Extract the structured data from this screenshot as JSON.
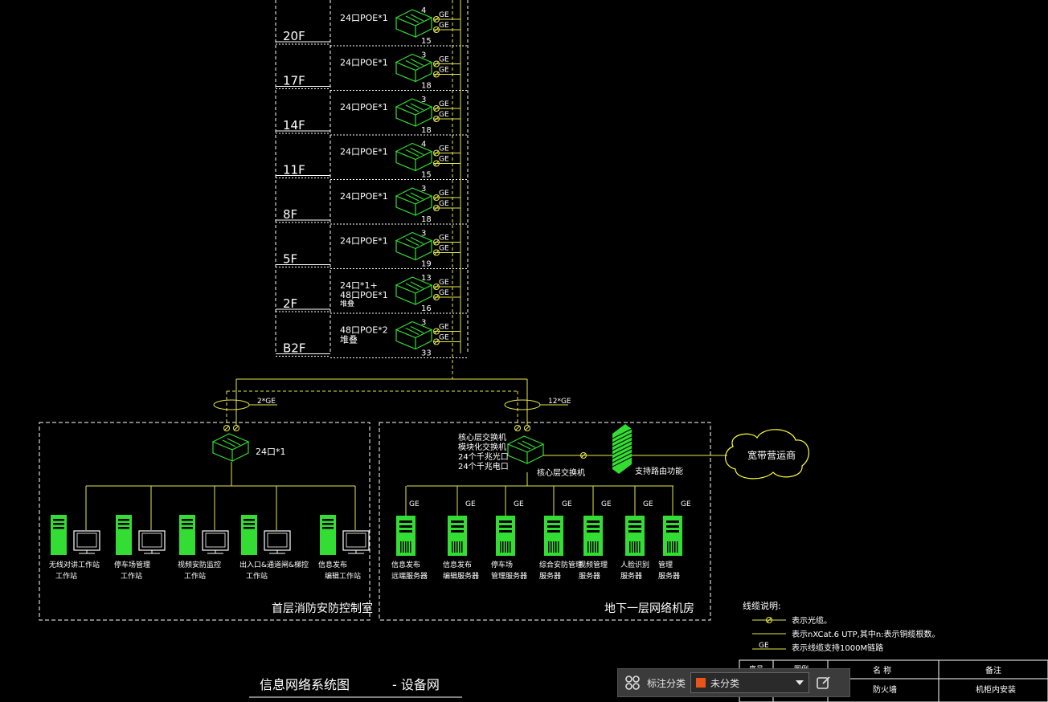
{
  "floors": [
    {
      "floor": "20F",
      "switch_label": "24口POE*1",
      "upper": "4",
      "lower": "15"
    },
    {
      "floor": "17F",
      "switch_label": "24口POE*1",
      "upper": "3",
      "lower": "18"
    },
    {
      "floor": "14F",
      "switch_label": "24口POE*1",
      "upper": "3",
      "lower": "18"
    },
    {
      "floor": "11F",
      "switch_label": "24口POE*1",
      "upper": "4",
      "lower": "15"
    },
    {
      "floor": "8F",
      "switch_label": "24口POE*1",
      "upper": "3",
      "lower": "18"
    },
    {
      "floor": "5F",
      "switch_label": "24口POE*1",
      "upper": "3",
      "lower": "19"
    },
    {
      "floor": "2F",
      "switch_label": "24口*1+",
      "switch_label2": "48口POE*1",
      "switch_label3": "堆叠",
      "upper": "13",
      "lower": "16"
    },
    {
      "floor": "B2F",
      "switch_label": "48口POE*2",
      "switch_label2": "堆叠",
      "upper": "3",
      "lower": "33"
    }
  ],
  "ge_label": "GE",
  "uplink_left": "2*GE",
  "uplink_right": "12*GE",
  "left_room": {
    "title": "首层消防安防控制室",
    "switch_label": "24口*1",
    "workstations": [
      {
        "line1": "无线对讲工作站",
        "line2": "工作站"
      },
      {
        "line1": "停车场管理",
        "line2": "工作站"
      },
      {
        "line1": "视频安防监控",
        "line2": "工作站"
      },
      {
        "line1": "出入口&通道闸&梯控",
        "line2": "工作站"
      },
      {
        "line1": "信息发布",
        "line2": "编辑工作站"
      }
    ]
  },
  "right_room": {
    "title": "地下一层网络机房",
    "core_desc": [
      "核心层交换机",
      "模块化交换机",
      "24个千兆光口",
      "24个千兆电口"
    ],
    "core_label": "核心层交换机",
    "firewall_label": "支持路由功能",
    "isp_label": "宽带营运商",
    "servers": [
      {
        "line1": "信息发布",
        "line2": "远端服务器"
      },
      {
        "line1": "信息发布",
        "line2": "编辑服务器"
      },
      {
        "line1": "停车场",
        "line2": "管理服务器"
      },
      {
        "line1": "综合安防管理",
        "line2": "服务器"
      },
      {
        "line1": "视频管理",
        "line2": "服务器"
      },
      {
        "line1": "人脸识别",
        "line2": "服务器"
      },
      {
        "line1": "管理",
        "line2": "服务器"
      }
    ]
  },
  "legend": {
    "title": "线缆说明:",
    "items": [
      {
        "symbol": "fiber",
        "text": "表示光缆。"
      },
      {
        "symbol": "utp",
        "text": "表示nXCat.6  UTP,其中n:表示铜缆根数。"
      },
      {
        "symbol": "ge",
        "label": "GE",
        "text": "表示线缆支持1000M链路"
      }
    ]
  },
  "drawing_title": {
    "main": "信息网络系统图",
    "sub": "- 设备网"
  },
  "table": {
    "headers": [
      "名  称",
      "备注"
    ],
    "row": [
      "防火墙",
      "机柜内安装"
    ],
    "partial": [
      "序号",
      "图例"
    ]
  },
  "toolbar": {
    "label": "标注分类",
    "selected": "未分类",
    "swatch_color": "#e8541a"
  },
  "colors": {
    "line": "#e8e84a",
    "box": "#ffffff",
    "device": "#33dd33",
    "cloud": "#ffff33",
    "text": "#ffffff"
  }
}
